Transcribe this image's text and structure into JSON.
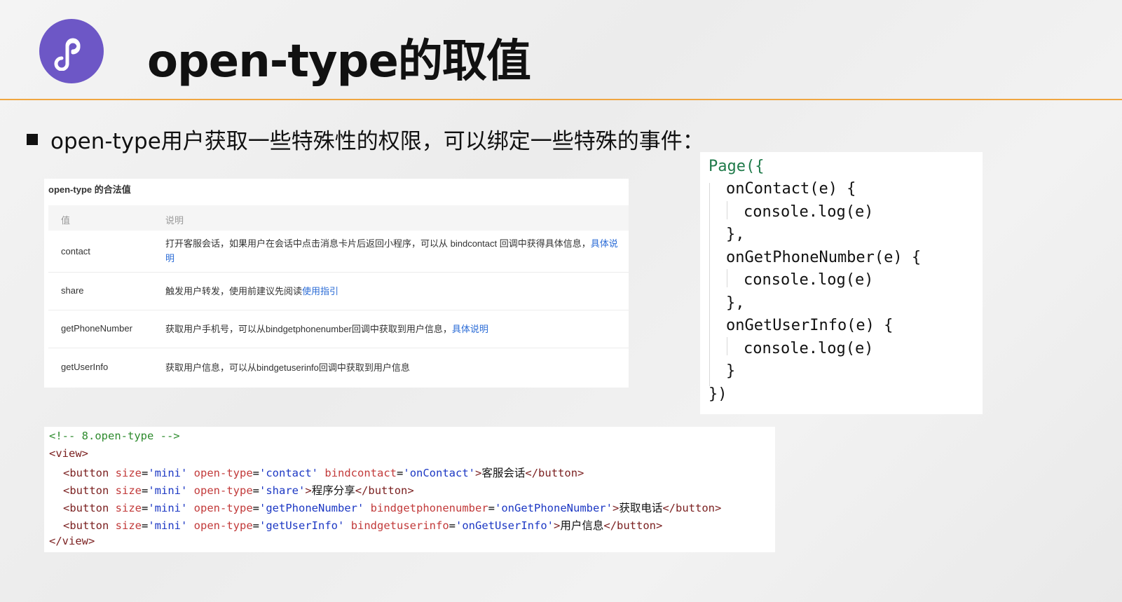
{
  "slide": {
    "title": "open-type的取值",
    "bullet": "open-type用户获取一些特殊性的权限，可以绑定一些特殊的事件："
  },
  "logo": {
    "icon": "miniprogram-logo-icon",
    "color": "#6d57c6"
  },
  "colors": {
    "accent_rule": "#f0a640",
    "link": "#2a6bd6"
  },
  "doc_table": {
    "caption": "open-type 的合法值",
    "headers": [
      "值",
      "说明"
    ],
    "rows": [
      {
        "value": "contact",
        "desc": "打开客服会话，如果用户在会话中点击消息卡片后返回小程序，可以从 bindcontact 回调中获得具体信息，",
        "link": "具体说明"
      },
      {
        "value": "share",
        "desc": "触发用户转发，使用前建议先阅读",
        "link": "使用指引"
      },
      {
        "value": "getPhoneNumber",
        "desc": "获取用户手机号，可以从bindgetphonenumber回调中获取到用户信息，",
        "link": "具体说明"
      },
      {
        "value": "getUserInfo",
        "desc": "获取用户信息，可以从bindgetuserinfo回调中获取到用户信息",
        "link": ""
      }
    ]
  },
  "js_code": {
    "lines": [
      "Page({",
      "onContact(e) {",
      "console.log(e)",
      "},",
      "onGetPhoneNumber(e) {",
      "console.log(e)",
      "},",
      "onGetUserInfo(e) {",
      "console.log(e)",
      "}",
      "})"
    ]
  },
  "wxml_code": {
    "comment": "<!-- 8.open-type -->",
    "open_view": "<view>",
    "close_view": "</view>",
    "buttons": [
      {
        "size": "'mini'",
        "open_type": "'contact'",
        "bind_attr": "bindcontact",
        "bind_value": "'onContact'",
        "text": "客服会话"
      },
      {
        "size": "'mini'",
        "open_type": "'share'",
        "bind_attr": "",
        "bind_value": "",
        "text": "程序分享"
      },
      {
        "size": "'mini'",
        "open_type": "'getPhoneNumber'",
        "bind_attr": "bindgetphonenumber",
        "bind_value": "'onGetPhoneNumber'",
        "text": "获取电话"
      },
      {
        "size": "'mini'",
        "open_type": "'getUserInfo'",
        "bind_attr": "bindgetuserinfo",
        "bind_value": "'onGetUserInfo'",
        "text": "用户信息"
      }
    ]
  }
}
